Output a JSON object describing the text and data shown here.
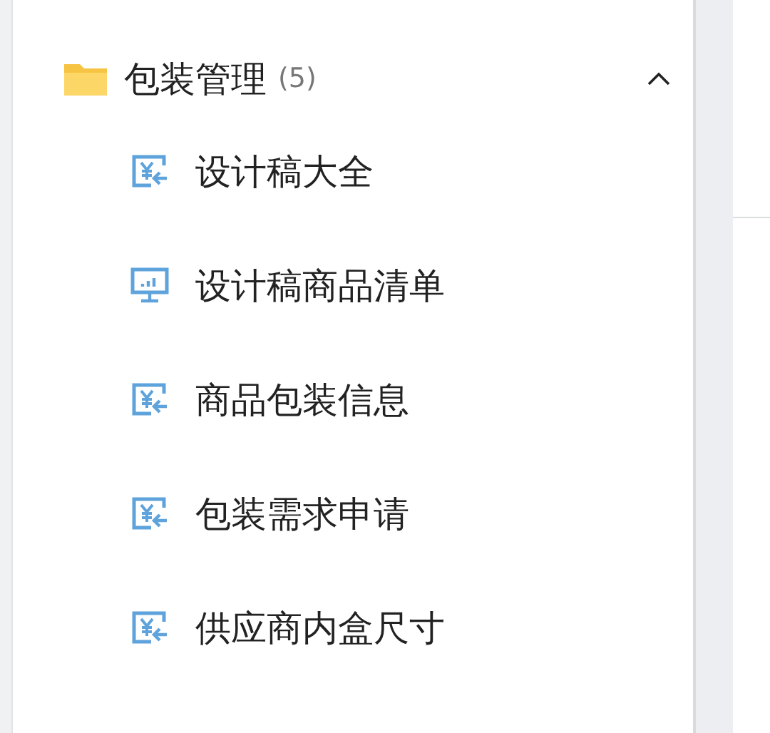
{
  "group": {
    "title": "包装管理",
    "count": "(5)",
    "expanded": true,
    "items": [
      {
        "label": "设计稿大全",
        "kind": "report"
      },
      {
        "label": "设计稿商品清单",
        "kind": "monitor"
      },
      {
        "label": "商品包装信息",
        "kind": "report"
      },
      {
        "label": "包装需求申请",
        "kind": "report"
      },
      {
        "label": "供应商内盒尺寸",
        "kind": "report"
      }
    ]
  }
}
